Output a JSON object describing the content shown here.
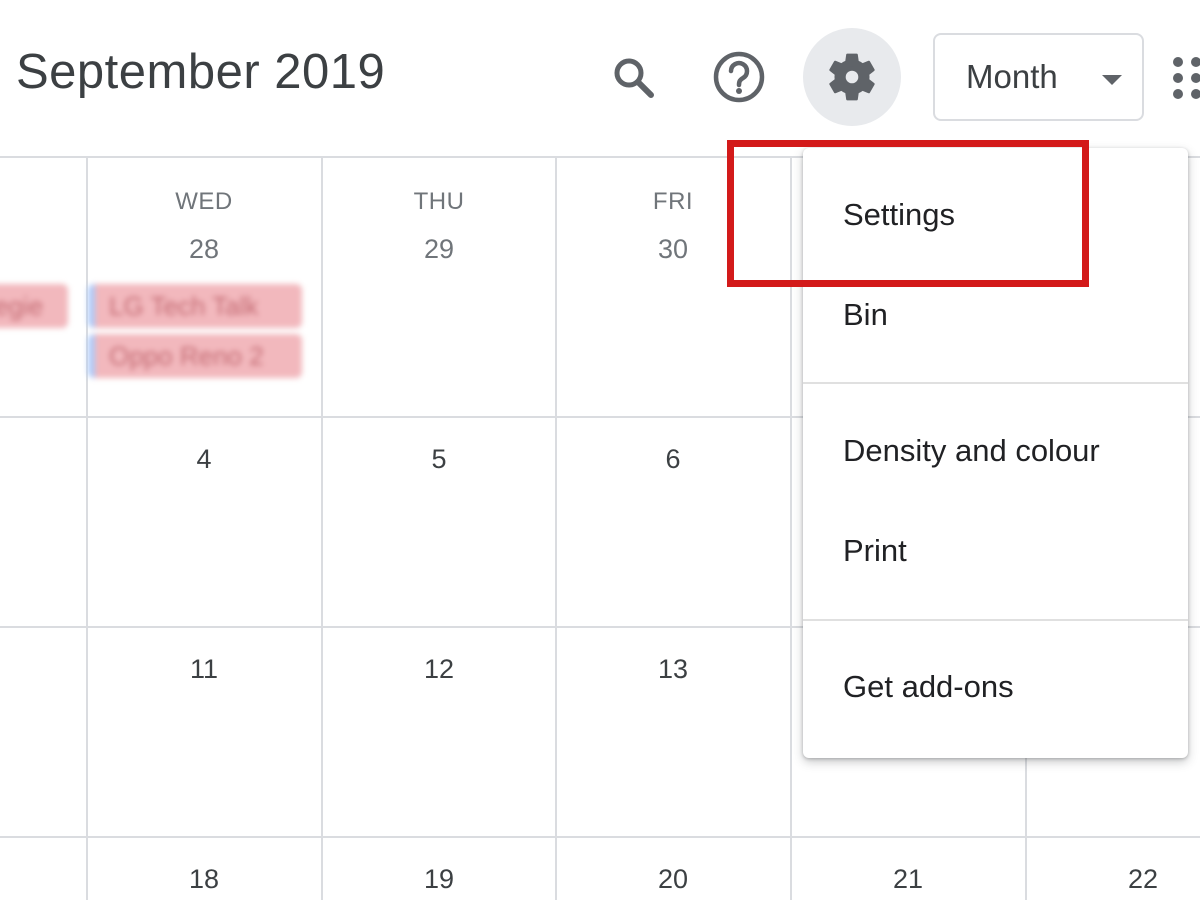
{
  "header": {
    "title": "September 2019",
    "icons": {
      "search": "search-icon",
      "help": "help-icon",
      "settings": "gear-icon",
      "apps": "apps-grid-icon"
    },
    "view_select": {
      "value": "Month"
    }
  },
  "calendar": {
    "weekdays": [
      "WED",
      "THU",
      "FRI"
    ],
    "first_row_dates": [
      "28",
      "29",
      "30"
    ],
    "rows": [
      [
        "4",
        "5",
        "6"
      ],
      [
        "11",
        "12",
        "13"
      ],
      [
        "18",
        "19",
        "20",
        "21",
        "22"
      ]
    ],
    "events": [
      {
        "label": "egie"
      },
      {
        "label": "LG Tech Talk"
      },
      {
        "label": "Oppo Reno 2"
      }
    ]
  },
  "settings_menu": {
    "items": [
      {
        "label": "Settings"
      },
      {
        "label": "Bin"
      },
      {
        "label": "Density and colour"
      },
      {
        "label": "Print"
      },
      {
        "label": "Get add-ons"
      }
    ]
  },
  "colors": {
    "accent_highlight": "#d31a1a",
    "event_pink": "#f2b8bd",
    "event_accent_blue": "#aecbfa",
    "grid_line": "#dadce0",
    "settings_button_bg": "#e8eaed"
  }
}
